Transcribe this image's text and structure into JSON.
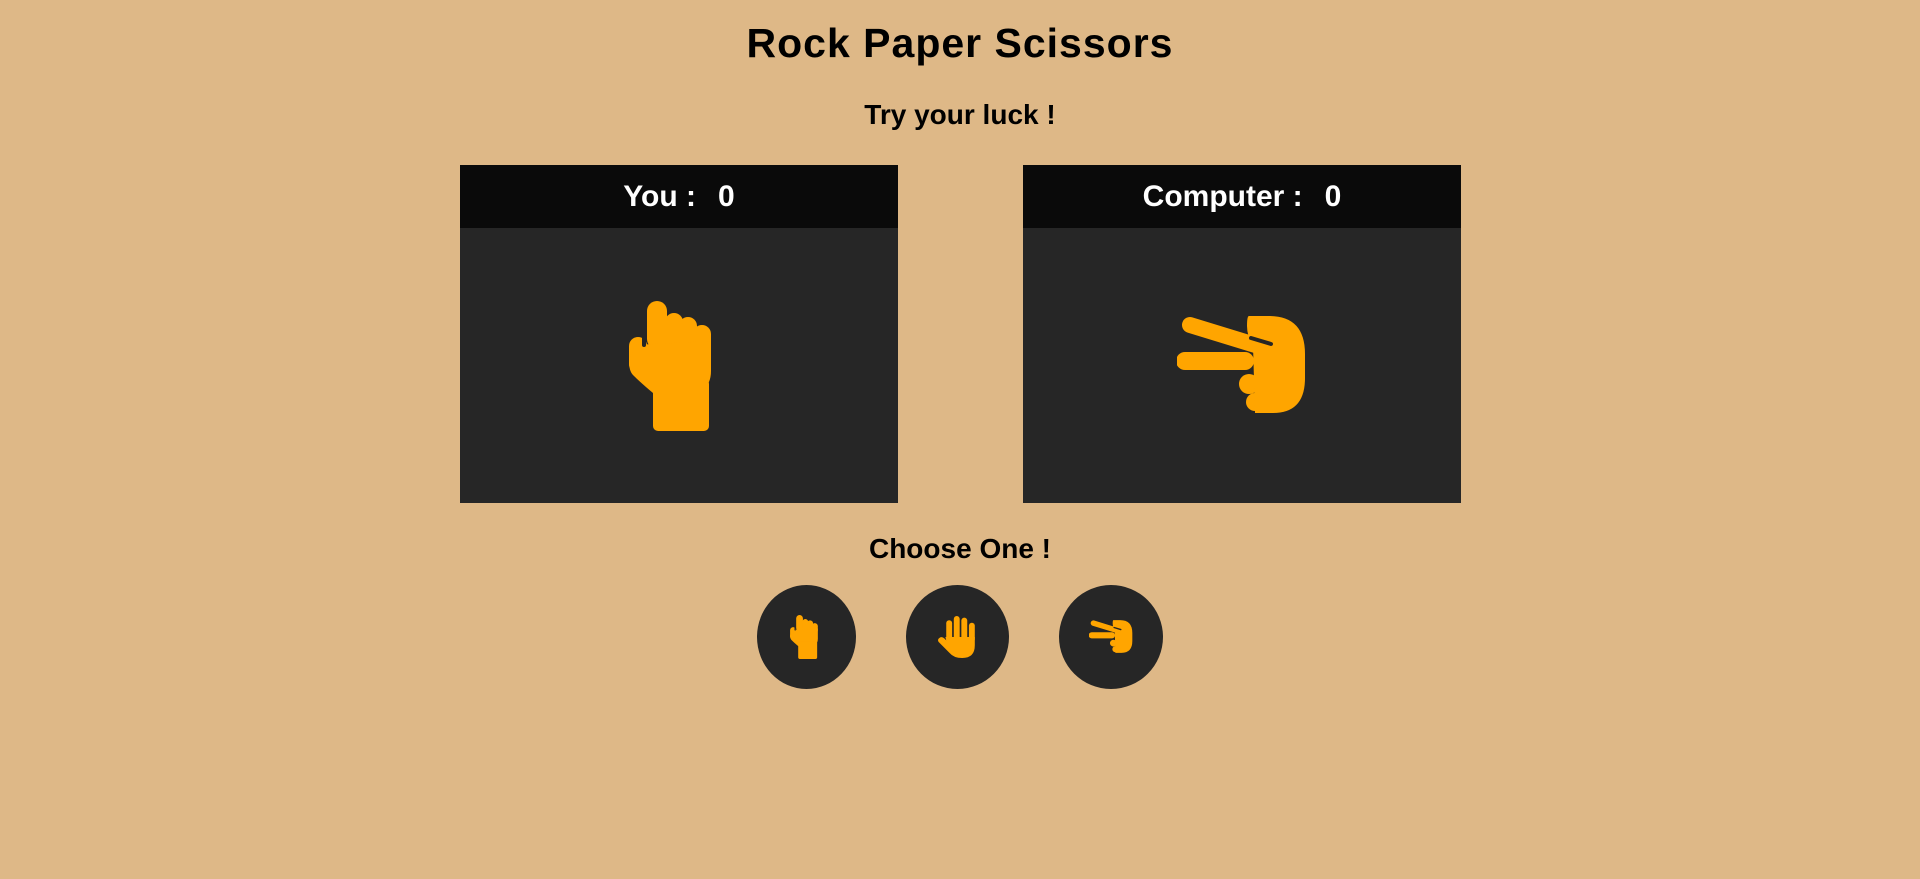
{
  "title": "Rock Paper Scissors",
  "subtitle": "Try your luck !",
  "player": {
    "label": "You :",
    "score": "0",
    "hand_icon": "hand-back-fist-icon"
  },
  "computer": {
    "label": "Computer :",
    "score": "0",
    "hand_icon": "hand-scissors-icon"
  },
  "choose_label": "Choose One !",
  "choices": [
    {
      "name": "rock",
      "icon": "hand-back-fist-icon"
    },
    {
      "name": "paper",
      "icon": "hand-paper-icon"
    },
    {
      "name": "scissors",
      "icon": "hand-scissors-icon"
    }
  ],
  "colors": {
    "background": "#deb887",
    "panel": "#262626",
    "panel_header": "#0a0a0a",
    "icon": "#ffa500"
  }
}
